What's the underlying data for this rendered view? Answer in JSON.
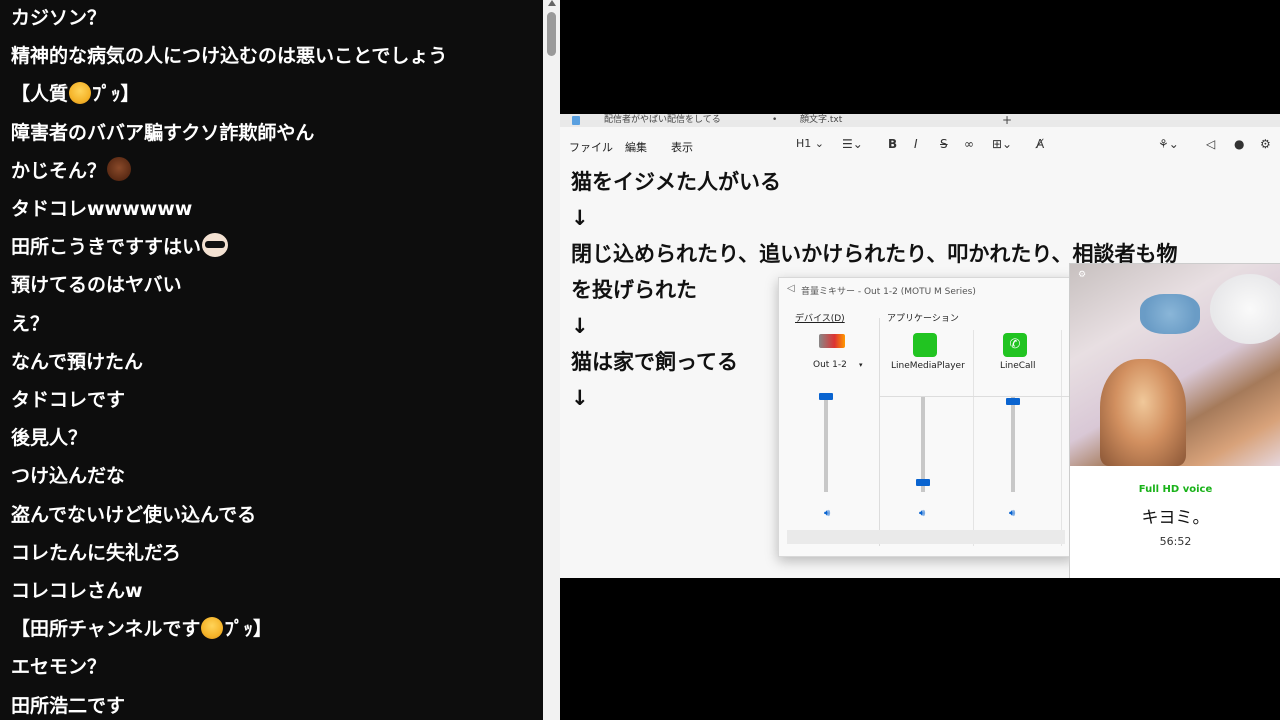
{
  "chat": {
    "messages": [
      {
        "text": "カジソン？"
      },
      {
        "text": "精神的な病気の人につけ込むのは悪いことでしょう"
      },
      {
        "text": "【人質",
        "emoji": "smirking-face",
        "suffix": "ﾌﾟｯ】"
      },
      {
        "text": "障害者のババア騙すクソ詐欺師やん"
      },
      {
        "text": "かじそん？",
        "emoji": "face-sticker",
        "suffix": ""
      },
      {
        "text": "タドコレwwwwww"
      },
      {
        "text": "田所こうきですすはい",
        "emoji": "sunglasses-face",
        "suffix": ""
      },
      {
        "text": "預けてるのはヤバい"
      },
      {
        "text": "え？"
      },
      {
        "text": "なんで預けたん"
      },
      {
        "text": "タドコレです"
      },
      {
        "text": "後見人？"
      },
      {
        "text": "つけ込んだな"
      },
      {
        "text": "盗んでないけど使い込んでる"
      },
      {
        "text": "コレたんに失礼だろ"
      },
      {
        "text": "コレコレさんw"
      },
      {
        "text": "【田所チャンネルです",
        "emoji": "smirking-face",
        "suffix": "ﾌﾟｯ】"
      },
      {
        "text": "エセモン？"
      },
      {
        "text": "田所浩二です"
      }
    ]
  },
  "notepad": {
    "tabs": [
      {
        "label": "配信者がやばい配信をしてる"
      },
      {
        "label": "顔文字.txt"
      }
    ],
    "new_tab": "+",
    "menus": [
      {
        "label": "ファイル"
      },
      {
        "label": "編集"
      },
      {
        "label": "表示"
      }
    ],
    "heading_select": "H1",
    "lines": [
      "猫をイジメた人がいる",
      "↓",
      "閉じ込められたり、追いかけられたり、叩かれたり、相談者も物",
      "を投げられた",
      "↓",
      "猫は家で飼ってる",
      "↓"
    ]
  },
  "mixer": {
    "title": "音量ミキサー - Out 1-2 (MOTU M Series)",
    "device_header": "デバイス(D)",
    "app_header": "アプリケーション",
    "device_name": "Out 1-2",
    "apps": [
      {
        "name": "LineMediaPlayer",
        "level": 0.1
      },
      {
        "name": "LineCall",
        "level": 0.95
      }
    ],
    "device_level": 1.0
  },
  "call": {
    "quality_label": "Full HD voice",
    "name": "キヨミ。",
    "duration": "56:52"
  },
  "colors": {
    "accent": "#0a64d0",
    "line_green": "#19b219",
    "chat_bg": "#0d0d0d"
  }
}
